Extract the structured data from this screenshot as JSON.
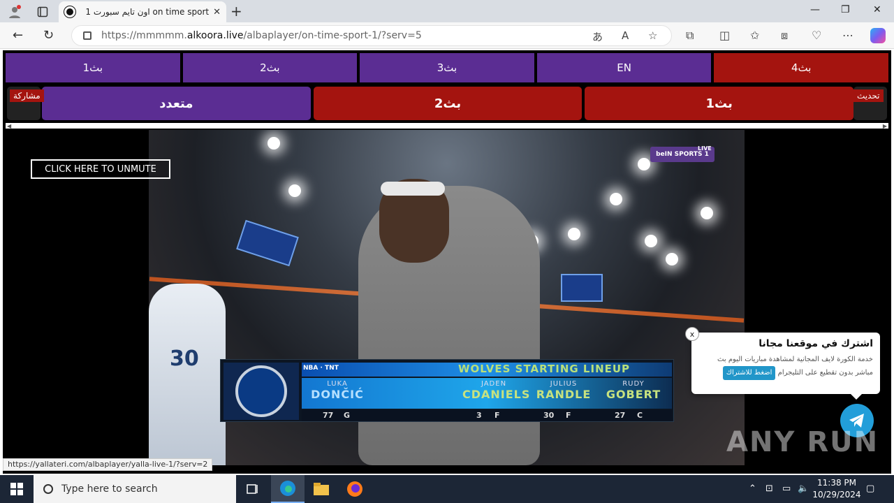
{
  "browser": {
    "tab_title": "اون تايم سبورت 1 on time sport",
    "tab_close": "✕",
    "new_tab": "+",
    "url_prefix": "https://mmmmm.",
    "url_domain": "alkoora.live",
    "url_path": "/albaplayer/on-time-sport-1/?serv=5"
  },
  "top_buttons": [
    "بث1",
    "بث2",
    "بث3",
    "EN",
    "بث4"
  ],
  "main_buttons": [
    "بث1",
    "بث2",
    "متعدد"
  ],
  "share_label": "مشاركة",
  "refresh_label": "تحديث",
  "video": {
    "unmute_label": "CLICK HERE TO UNMUTE",
    "channel_badge": "beIN SPORTS 1",
    "live_label": "LIVE",
    "lineup": {
      "header": "WOLVES STARTING LINEUP",
      "players": [
        {
          "first": "LUKA",
          "last": "DONČIĆ",
          "number": "77",
          "pos": "G"
        },
        {
          "first": "JADEN",
          "last": "CDANIELS",
          "number": "3",
          "pos": "F"
        },
        {
          "first": "JULIUS",
          "last": "RANDLE",
          "number": "30",
          "pos": "F"
        },
        {
          "first": "RUDY",
          "last": "GOBERT",
          "number": "27",
          "pos": "C"
        }
      ]
    },
    "jersey_number": "30"
  },
  "popup": {
    "close": "x",
    "heading": "اشترك في موقعنا مجانا",
    "text": "خدمة الكورة لايف المجانية لمشاهدة مباريات اليوم بث مباشر بدون تقطيع على التليجرام",
    "button": "اضغط للاشتراك"
  },
  "watermark": "ANY RUN",
  "status_url": "https://yallateri.com/albaplayer/yalla-live-1/?serv=2",
  "taskbar": {
    "search_placeholder": "Type here to search",
    "time": "11:38 PM",
    "date": "10/29/2024"
  },
  "colors": {
    "purple": "#5b2d93",
    "red": "#a4140f",
    "telegram": "#229ed9"
  }
}
